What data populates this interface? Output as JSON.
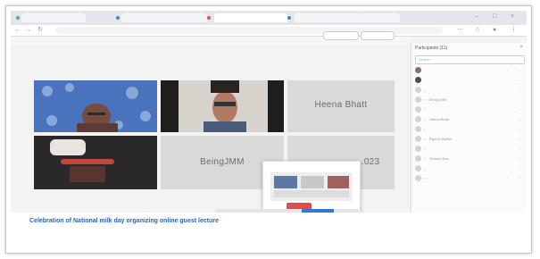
{
  "browser": {
    "tabs": [
      "",
      "",
      "",
      "",
      ""
    ],
    "url": ""
  },
  "meeting": {
    "toolbar_text": "",
    "tiles": [
      {
        "name": "Heena Bhatt"
      },
      {
        "name": "BeingJMM"
      },
      {
        "name": "...023"
      }
    ],
    "buttons": {
      "left_pill": "",
      "right_pill": ""
    }
  },
  "participants": {
    "title": "Participants (11)",
    "close_icon": "close-icon",
    "search_placeholder": "Search",
    "items": [
      {
        "name": ""
      },
      {
        "name": ""
      },
      {
        "name": ""
      },
      {
        "name": "BeingJMM"
      },
      {
        "name": ""
      },
      {
        "name": "Heena Bhatt"
      },
      {
        "name": ""
      },
      {
        "name": "Riya B Vadher"
      },
      {
        "name": ""
      },
      {
        "name": "Shimad Des"
      },
      {
        "name": ""
      },
      {
        "name": ""
      }
    ]
  },
  "share_popup": {
    "title": "",
    "button": ""
  },
  "caption": "Celebration of National milk day organizing online guest lecture",
  "colors": {
    "caption": "#2c64b4",
    "popup_button": "#e14b4b",
    "blue_button": "#2e7bd6"
  }
}
